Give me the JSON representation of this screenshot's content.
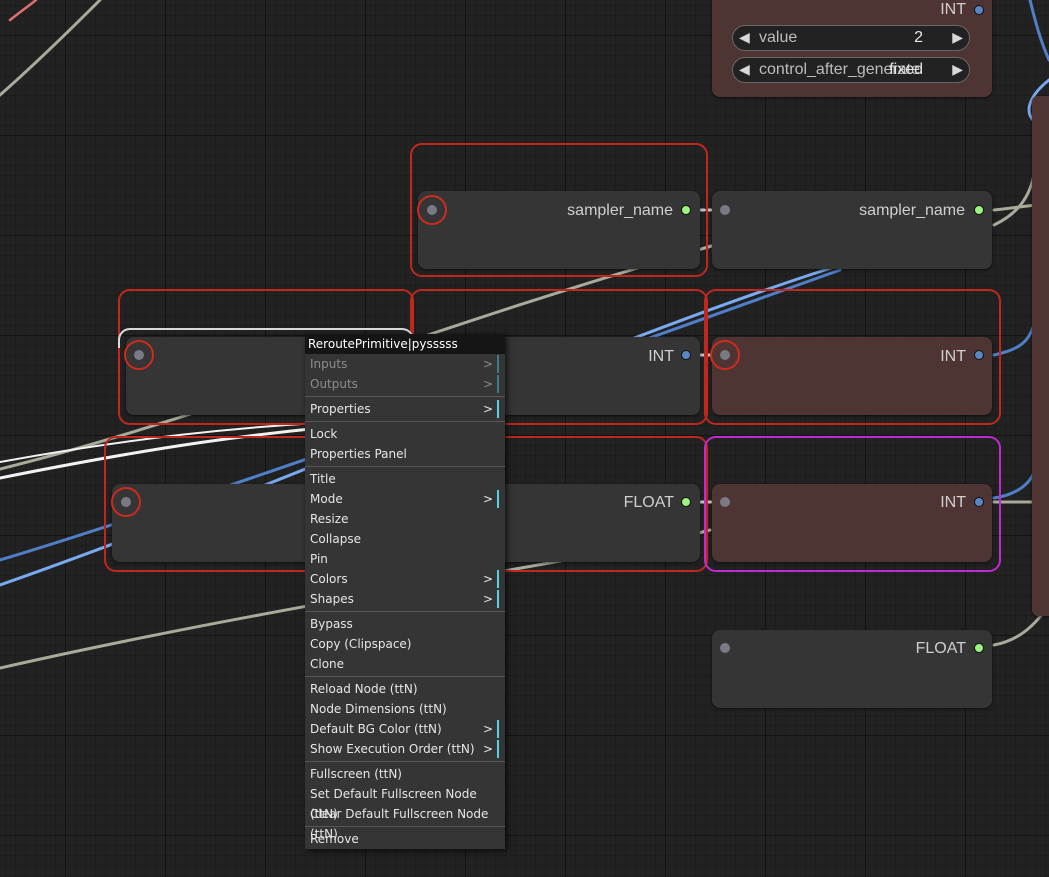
{
  "canvas": {
    "nodes": {
      "int_primitive": {
        "output_label": "INT",
        "widget_value_name": "value",
        "widget_value": "2",
        "widget_control_name": "control_after_generate",
        "widget_control_value": "fixed"
      },
      "reroute_sampler_left": {
        "output_label": "sampler_name"
      },
      "reroute_sampler_right": {
        "output_label": "sampler_name"
      },
      "reroute_int_mid": {
        "output_label": "INT"
      },
      "reroute_int_right": {
        "output_label": "INT"
      },
      "reroute_float_mid": {
        "output_label": "FLOAT"
      },
      "reroute_int_bottom_right": {
        "output_label": "INT"
      },
      "reroute_float_bottom": {
        "output_label": "FLOAT"
      }
    }
  },
  "context_menu": {
    "title": "ReroutePrimitive|pysssss",
    "groups": [
      [
        {
          "label": "Inputs",
          "disabled": true,
          "submenu": true
        },
        {
          "label": "Outputs",
          "disabled": true,
          "submenu": true
        }
      ],
      [
        {
          "label": "Properties",
          "disabled": false,
          "submenu": true
        }
      ],
      [
        {
          "label": "Lock",
          "disabled": false,
          "submenu": false
        },
        {
          "label": "Properties Panel",
          "disabled": false,
          "submenu": false
        }
      ],
      [
        {
          "label": "Title",
          "disabled": false,
          "submenu": false
        },
        {
          "label": "Mode",
          "disabled": false,
          "submenu": true
        },
        {
          "label": "Resize",
          "disabled": false,
          "submenu": false
        },
        {
          "label": "Collapse",
          "disabled": false,
          "submenu": false
        },
        {
          "label": "Pin",
          "disabled": false,
          "submenu": false
        },
        {
          "label": "Colors",
          "disabled": false,
          "submenu": true
        },
        {
          "label": "Shapes",
          "disabled": false,
          "submenu": true
        }
      ],
      [
        {
          "label": "Bypass",
          "disabled": false,
          "submenu": false
        },
        {
          "label": "Copy (Clipspace)",
          "disabled": false,
          "submenu": false
        },
        {
          "label": "Clone",
          "disabled": false,
          "submenu": false
        }
      ],
      [
        {
          "label": "Reload Node (ttN)",
          "disabled": false,
          "submenu": false
        },
        {
          "label": "Node Dimensions (ttN)",
          "disabled": false,
          "submenu": false
        },
        {
          "label": "Default BG Color (ttN)",
          "disabled": false,
          "submenu": true
        },
        {
          "label": "Show Execution Order (ttN)",
          "disabled": false,
          "submenu": true
        }
      ],
      [
        {
          "label": "Fullscreen (ttN)",
          "disabled": false,
          "submenu": false
        },
        {
          "label": "Set Default Fullscreen Node (ttN)",
          "disabled": false,
          "submenu": false
        },
        {
          "label": "Clear Default Fullscreen Node (ttN)",
          "disabled": false,
          "submenu": false
        }
      ],
      [
        {
          "label": "Remove",
          "disabled": false,
          "submenu": false
        }
      ]
    ],
    "submenu_glyph": ">"
  },
  "colors": {
    "canvas_bg": "#222222",
    "node_bg": "#353535",
    "node_bg_int": "#4f3434",
    "selection_red": "#c0281e",
    "selection_pink": "#c02ad0",
    "menu_bg": "#353535",
    "menu_title_bg": "#151515",
    "submenu_marker": "#4fd6e8",
    "slot_string": "#9af57c",
    "slot_int": "#5a86c4"
  }
}
